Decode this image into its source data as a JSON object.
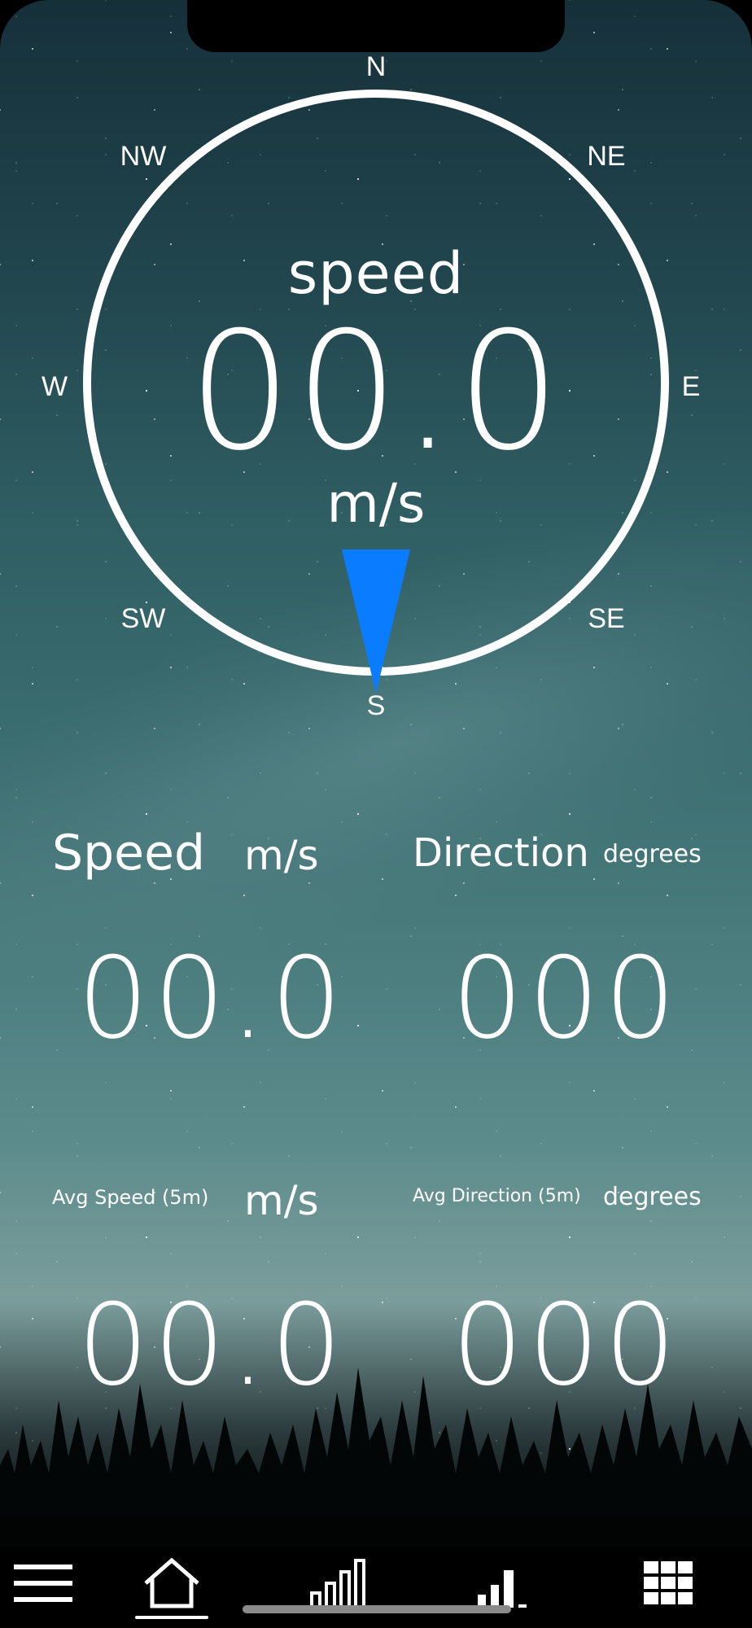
{
  "compass": {
    "n": "N",
    "ne": "NE",
    "e": "E",
    "se": "SE",
    "s": "S",
    "sw": "SW",
    "w": "W",
    "nw": "NW",
    "label": "speed",
    "value": "00.0",
    "unit": "m/s",
    "pointer_color": "#0a7cff"
  },
  "current": {
    "speed_label": "Speed",
    "speed_unit": "m/s",
    "speed_value": "00.0",
    "direction_label": "Direction",
    "direction_unit": "degrees",
    "direction_value": "000"
  },
  "average": {
    "speed_label": "Avg Speed (5m)",
    "speed_unit": "m/s",
    "speed_value": "00.0",
    "direction_label": "Avg Direction (5m)",
    "direction_unit": "degrees",
    "direction_value": "000"
  },
  "tabbar": {
    "items": [
      {
        "icon": "menu-icon"
      },
      {
        "icon": "home-icon",
        "active": true
      },
      {
        "icon": "bar-chart-icon"
      },
      {
        "icon": "signal-bars-icon"
      },
      {
        "icon": "grid-icon"
      }
    ]
  }
}
